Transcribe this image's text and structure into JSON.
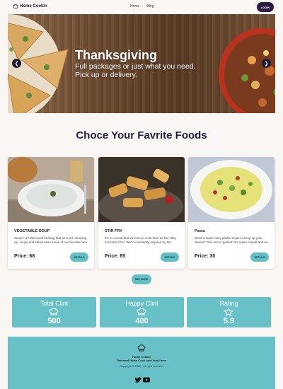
{
  "nav": {
    "brand": "Home Cookin",
    "links": [
      "Home",
      "Blog"
    ],
    "login_label": "LOGIN"
  },
  "hero": {
    "title": "Thanksgiving",
    "subtitle": "Full packages or just what you need. Pick up or delivery."
  },
  "section_title": "Choce Your Favrite Foods",
  "cards": [
    {
      "title": "VEGETABLE SOUP",
      "description": "Soup's on! We loved hearing that as a kid. Growing up, soups and stews were some of our favorite mea",
      "price": "Price: 68",
      "button": "DETAILS"
    },
    {
      "title": "STIR FRY",
      "description": "It's no secret that we love to cook here at The Stay at Home Chef. We're constantly inspired by the",
      "price": "Price: 65",
      "button": "DETAILS"
    },
    {
      "title": "Pasta",
      "description": "Need a super easy pasta recipe to keep up your sleeve? This one is perfect! It's super simple and ea",
      "price": "Price: 30",
      "button": "DETAILS"
    }
  ],
  "see_more_label": "SEE MORE",
  "stats": [
    {
      "label": "Total Clint",
      "value": "500",
      "icon": "chef-hat-icon"
    },
    {
      "label": "Happy Clint",
      "value": "400",
      "icon": "chef-hat-icon"
    },
    {
      "label": "Rating",
      "value": "5.9",
      "icon": "star-icon"
    }
  ],
  "footer": {
    "brand": "Home Cookin",
    "tagline": "Personal Home Cook best Food Item",
    "copyright": "Copyright © 2022 - All right reserved"
  },
  "colors": {
    "accent": "#67c1c6",
    "dark": "#2c1a45",
    "background": "#faf6f3"
  }
}
